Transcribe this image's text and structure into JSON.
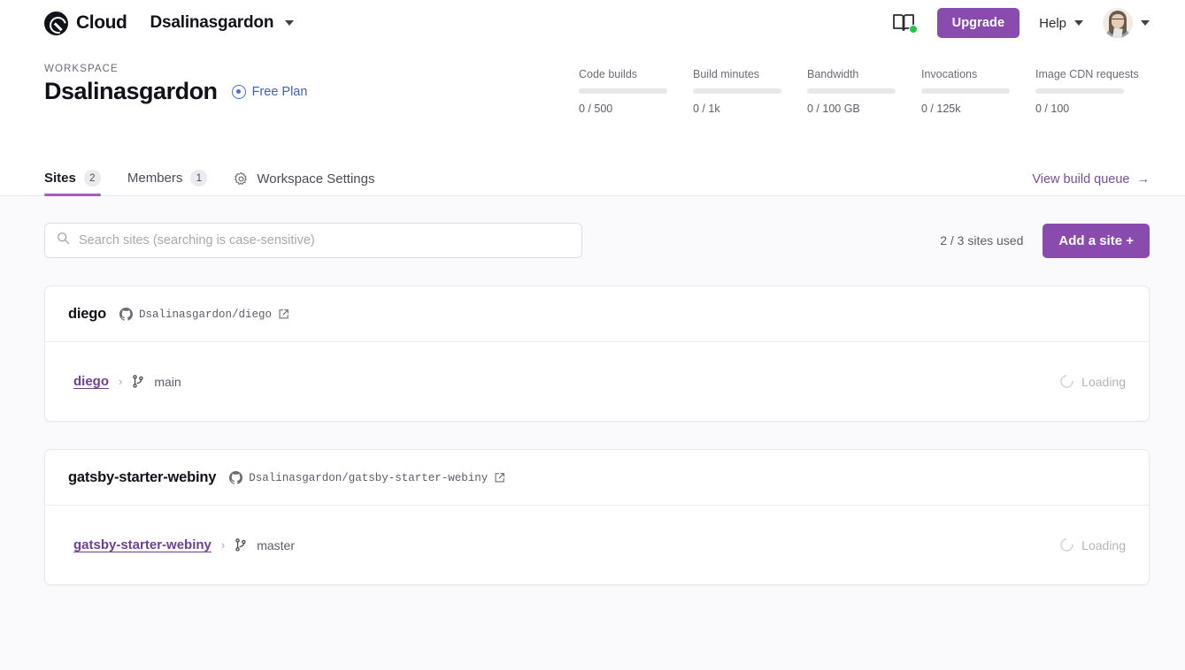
{
  "topnav": {
    "brand_name": "Cloud",
    "brand_icon": "gatsby-logo-icon",
    "workspace_switcher": "Dsalinasgardon",
    "docs_icon": "book-icon",
    "upgrade_label": "Upgrade",
    "help_label": "Help",
    "avatar_name": "user-avatar"
  },
  "workspace": {
    "kicker": "WORKSPACE",
    "title": "Dsalinasgardon",
    "plan_label": "Free Plan",
    "metrics": [
      {
        "label": "Code builds",
        "value": "0 / 500",
        "percent": 0
      },
      {
        "label": "Build minutes",
        "value": "0 / 1k",
        "percent": 0
      },
      {
        "label": "Bandwidth",
        "value": "0 / 100 GB",
        "percent": 0
      },
      {
        "label": "Invocations",
        "value": "0 / 125k",
        "percent": 0
      },
      {
        "label": "Image CDN requests",
        "value": "0 / 100",
        "percent": 0
      }
    ]
  },
  "tabs": {
    "items": [
      {
        "label": "Sites",
        "badge": "2",
        "active": true
      },
      {
        "label": "Members",
        "badge": "1",
        "active": false
      },
      {
        "label": "Workspace Settings",
        "badge": "",
        "active": false
      }
    ],
    "build_queue_label": "View build queue",
    "build_queue_arrow": "→"
  },
  "toolbar": {
    "search_placeholder": "Search sites (searching is case-sensitive)",
    "search_value": "",
    "sites_used": "2 / 3 sites used",
    "add_site_label": "Add a site",
    "add_site_plus": "+"
  },
  "sites": [
    {
      "name": "diego",
      "repo": "Dsalinasgardon/diego",
      "branch_site": "diego",
      "separator": "›",
      "branch": "main",
      "status": "Loading"
    },
    {
      "name": "gatsby-starter-webiny",
      "repo": "Dsalinasgardon/gatsby-starter-webiny",
      "branch_site": "gatsby-starter-webiny",
      "separator": "›",
      "branch": "master",
      "status": "Loading"
    }
  ],
  "colors": {
    "brand_purple": "#8a4baf",
    "tab_underline": "#a05ec0",
    "link_purple": "#7c4aa0",
    "plan_blue": "#3f5fc4",
    "status_green": "#26c643",
    "page_bg": "#faf9fb"
  }
}
